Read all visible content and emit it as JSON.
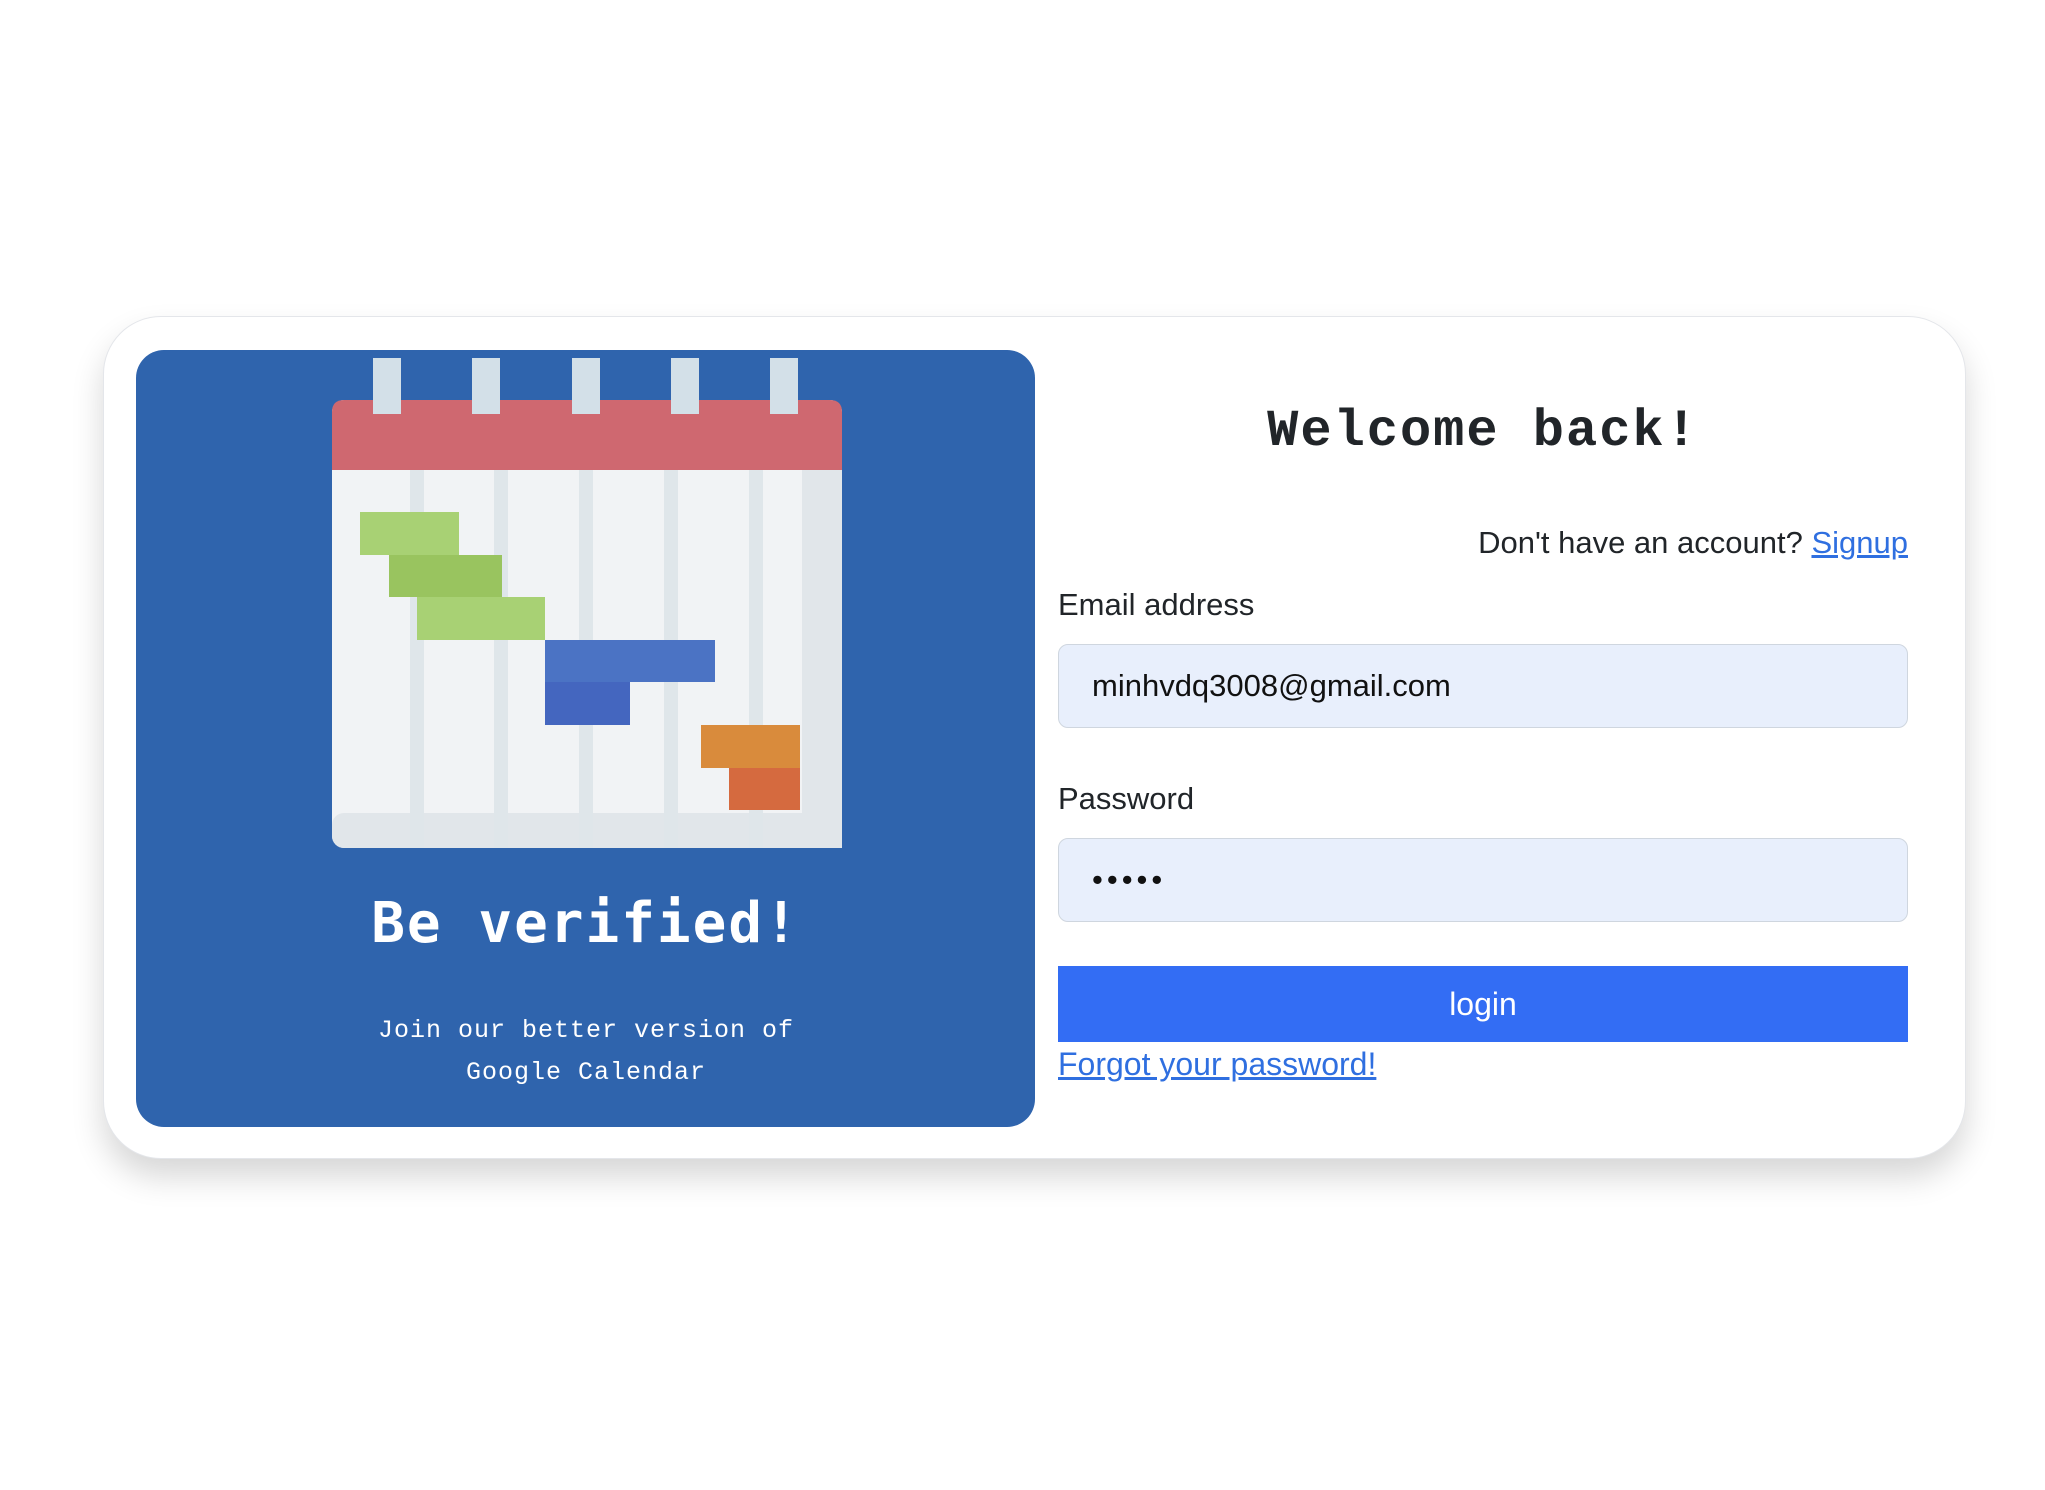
{
  "hero": {
    "title": "Be verified!",
    "subtitle": "Join our better version of Google Calendar",
    "illustration_icon": "gantt-calendar-icon",
    "background_color": "#2f64ad"
  },
  "form": {
    "title": "Welcome back!",
    "signup_prompt": "Don't have an account?",
    "signup_link": "Signup",
    "email_label": "Email address",
    "email_value": "minhvdq3008@gmail.com",
    "password_label": "Password",
    "password_value": "•••••",
    "login_label": "login",
    "forgot_link": "Forgot your password!"
  },
  "colors": {
    "accent": "#336df4",
    "link": "#2f6fe0",
    "input_bg": "#e8effc"
  }
}
